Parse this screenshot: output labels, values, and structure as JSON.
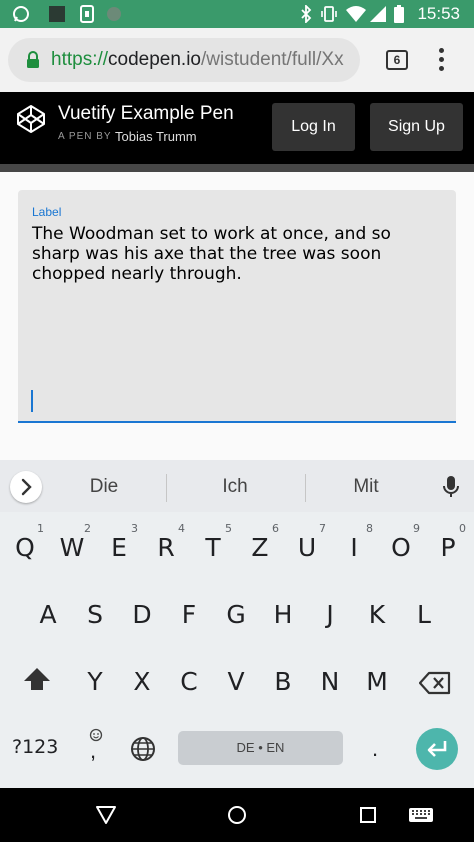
{
  "status_bar": {
    "time": "15:53",
    "left_icons": [
      "whatsapp-icon",
      "app-square-icon",
      "sim-card-icon",
      "circle-icon"
    ],
    "right_icons": [
      "bluetooth-icon",
      "vibrate-icon",
      "wifi-icon",
      "signal-icon",
      "battery-icon"
    ],
    "color": "#3a9a6b"
  },
  "browser": {
    "url_scheme": "https://",
    "url_host": "codepen.io",
    "url_path": "/wistudent/full/Xx",
    "tab_count": "6"
  },
  "codepen": {
    "pen_title": "Vuetify Example Pen",
    "pen_by": "A PEN BY",
    "author": "Tobias Trumm",
    "login_label": "Log In",
    "signup_label": "Sign Up"
  },
  "textarea": {
    "label": "Label",
    "value": "The Woodman set to work at once, and so sharp was his axe that the tree was soon chopped nearly through.",
    "accent": "#1976d2"
  },
  "keyboard": {
    "suggestions": [
      "Die",
      "Ich",
      "Mit"
    ],
    "row1": [
      {
        "key": "Q",
        "hint": "1"
      },
      {
        "key": "W",
        "hint": "2"
      },
      {
        "key": "E",
        "hint": "3"
      },
      {
        "key": "R",
        "hint": "4"
      },
      {
        "key": "T",
        "hint": "5"
      },
      {
        "key": "Z",
        "hint": "6"
      },
      {
        "key": "U",
        "hint": "7"
      },
      {
        "key": "I",
        "hint": "8"
      },
      {
        "key": "O",
        "hint": "9"
      },
      {
        "key": "P",
        "hint": "0"
      }
    ],
    "row2": [
      "A",
      "S",
      "D",
      "F",
      "G",
      "H",
      "J",
      "K",
      "L"
    ],
    "row3": [
      "Y",
      "X",
      "C",
      "V",
      "B",
      "N",
      "M"
    ],
    "symbols_label": "?123",
    "comma": ",",
    "period": ".",
    "space_label": "DE • EN",
    "enter_color": "#4db6ac"
  }
}
